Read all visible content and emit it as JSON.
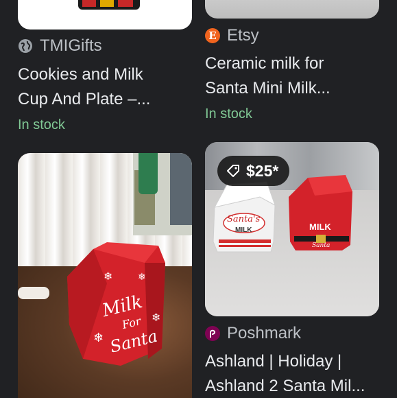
{
  "colors": {
    "background": "#202124",
    "stock_green": "#81c995",
    "source_gray": "#bdc1c6"
  },
  "cards": [
    {
      "source": "TMIGifts",
      "source_icon": "globe-icon",
      "title_line1": "Cookies and Milk",
      "title_line2": "Cup And Plate –...",
      "stock": "In stock"
    },
    {
      "source": "Etsy",
      "source_icon": "etsy-icon",
      "source_icon_letter": "E",
      "title_line1": "Ceramic milk for",
      "title_line2": "Santa Mini Milk...",
      "stock": "In stock"
    },
    {
      "image_text_line1": "Milk",
      "image_text_line2": "For",
      "image_text_line3": "Santa"
    },
    {
      "price": "$25*",
      "price_icon": "tag-icon",
      "image_label_left_1": "Santa's",
      "image_label_left_2": "MILK",
      "image_label_right_1": "MILK",
      "image_label_right_2": "Santa",
      "source": "Poshmark",
      "source_icon": "poshmark-icon",
      "title_line1": "Ashland | Holiday |",
      "title_line2": "Ashland 2 Santa Mil..."
    }
  ]
}
